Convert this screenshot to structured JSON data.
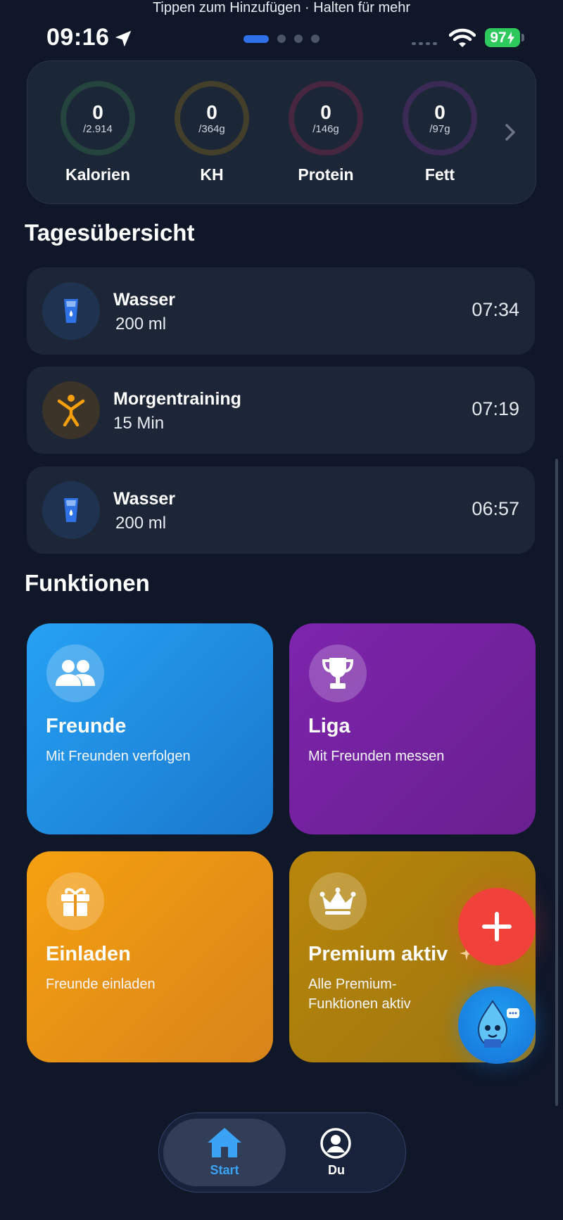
{
  "status_bar": {
    "hint": "Tippen zum Hinzufügen · Halten für mehr",
    "time": "09:16",
    "battery": "97"
  },
  "macros": [
    {
      "value": "0",
      "goal": "/2.914",
      "label": "Kalorien",
      "color": "#2b4a40"
    },
    {
      "value": "0",
      "goal": "/364g",
      "label": "KH",
      "color": "#4a4530"
    },
    {
      "value": "0",
      "goal": "/146g",
      "label": "Protein",
      "color": "#4d2a44"
    },
    {
      "value": "0",
      "goal": "/97g",
      "label": "Fett",
      "color": "#3f2c5a"
    }
  ],
  "overview": {
    "title": "Tagesübersicht",
    "entries": [
      {
        "title": "Wasser",
        "subtitle": "200 ml",
        "time": "07:34",
        "icon": "water-glass-icon"
      },
      {
        "title": "Morgentraining",
        "subtitle": "15 Min",
        "time": "07:19",
        "icon": "person-exercise-icon"
      },
      {
        "title": "Wasser",
        "subtitle": "200 ml",
        "time": "06:57",
        "icon": "water-glass-icon"
      }
    ]
  },
  "features": {
    "title": "Funktionen",
    "tiles": [
      {
        "title": "Freunde",
        "subtitle": "Mit Freunden verfolgen",
        "icon": "friends-icon",
        "color": "#2196f3"
      },
      {
        "title": "Liga",
        "subtitle": "Mit Freunden messen",
        "icon": "trophy-icon",
        "color": "#7b22a8"
      },
      {
        "title": "Einladen",
        "subtitle": "Freunde einladen",
        "icon": "gift-icon",
        "color": "#f39c12"
      },
      {
        "title": "Premium aktiv",
        "subtitle_line1": "Alle Premium-",
        "subtitle_line2": "Funktionen aktiv",
        "icon": "crown-icon",
        "color": "#b8860b"
      }
    ]
  },
  "tabs": [
    {
      "label": "Start",
      "icon": "home-icon",
      "active": true,
      "color": "#3aa3f5"
    },
    {
      "label": "Du",
      "icon": "profile-icon",
      "active": false
    }
  ]
}
